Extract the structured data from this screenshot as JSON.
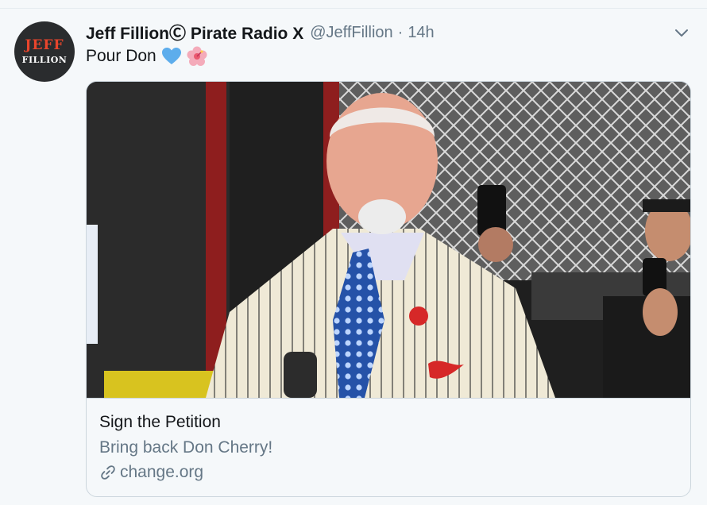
{
  "tweet": {
    "author": {
      "display_name": "Jeff FillionⒸ Pirate Radio X",
      "handle": "@JeffFillion",
      "avatar_line1": "JEFF",
      "avatar_line2": "FILLION"
    },
    "separator": "·",
    "time": "14h",
    "text": "Pour Don",
    "emojis": [
      "blue-heart-icon",
      "hibiscus-icon"
    ]
  },
  "card": {
    "image": "photo of Don Cherry in a cream pinstripe suit and blue polka-dot tie",
    "title": "Sign the Petition",
    "description": "Bring back Don Cherry!",
    "domain": "change.org",
    "link_icon": "link-icon"
  },
  "menu": {
    "icon": "chevron-down-icon"
  },
  "colors": {
    "primary_text": "#14171a",
    "secondary_text": "#657786",
    "border": "#ccd6dd",
    "background": "#f5f8fa"
  }
}
